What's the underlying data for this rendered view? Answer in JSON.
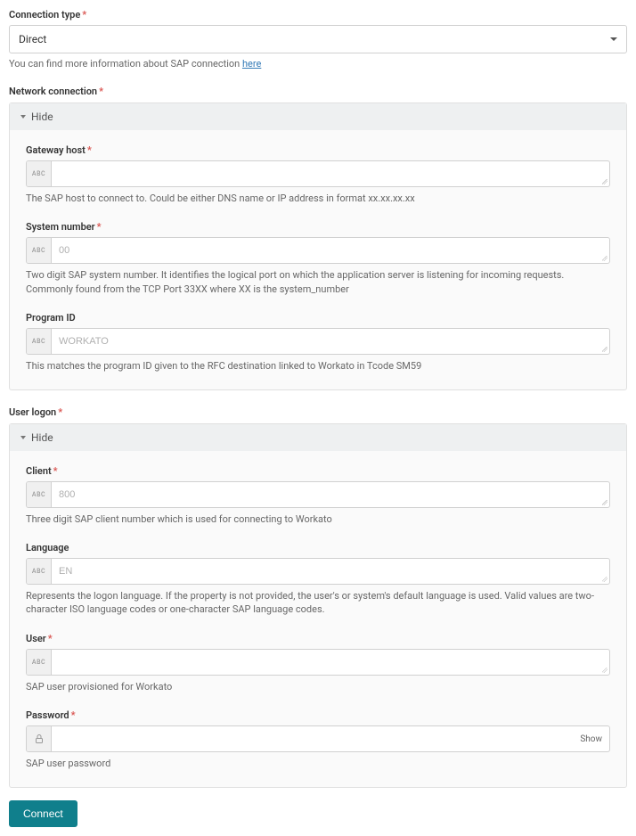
{
  "connectionType": {
    "label": "Connection type",
    "value": "Direct",
    "infoPrefix": "You can find more information about SAP connection ",
    "infoLink": "here"
  },
  "networkConnection": {
    "header": "Network connection",
    "toggle": "Hide",
    "gatewayHost": {
      "label": "Gateway host",
      "prefix": "ABC",
      "value": "",
      "helper": "The SAP host to connect to. Could be either DNS name or IP address in format xx.xx.xx.xx"
    },
    "systemNumber": {
      "label": "System number",
      "prefix": "ABC",
      "placeholder": "00",
      "value": "",
      "helper": "Two digit SAP system number. It identifies the logical port on which the application server is listening for incoming requests. Commonly found from the TCP Port 33XX where XX is the system_number"
    },
    "programId": {
      "label": "Program ID",
      "prefix": "ABC",
      "placeholder": "WORKATO",
      "value": "",
      "helper": "This matches the program ID given to the RFC destination linked to Workato in Tcode SM59"
    }
  },
  "userLogon": {
    "header": "User logon",
    "toggle": "Hide",
    "client": {
      "label": "Client",
      "prefix": "ABC",
      "placeholder": "800",
      "value": "",
      "helper": "Three digit SAP client number which is used for connecting to Workato"
    },
    "language": {
      "label": "Language",
      "prefix": "ABC",
      "placeholder": "EN",
      "value": "",
      "helper": "Represents the logon language. If the property is not provided, the user's or system's default language is used. Valid values are two-character ISO language codes or one-character SAP language codes."
    },
    "user": {
      "label": "User",
      "prefix": "ABC",
      "value": "",
      "helper": "SAP user provisioned for Workato"
    },
    "password": {
      "label": "Password",
      "show": "Show",
      "value": "",
      "helper": "SAP user password"
    }
  },
  "connectButton": "Connect"
}
